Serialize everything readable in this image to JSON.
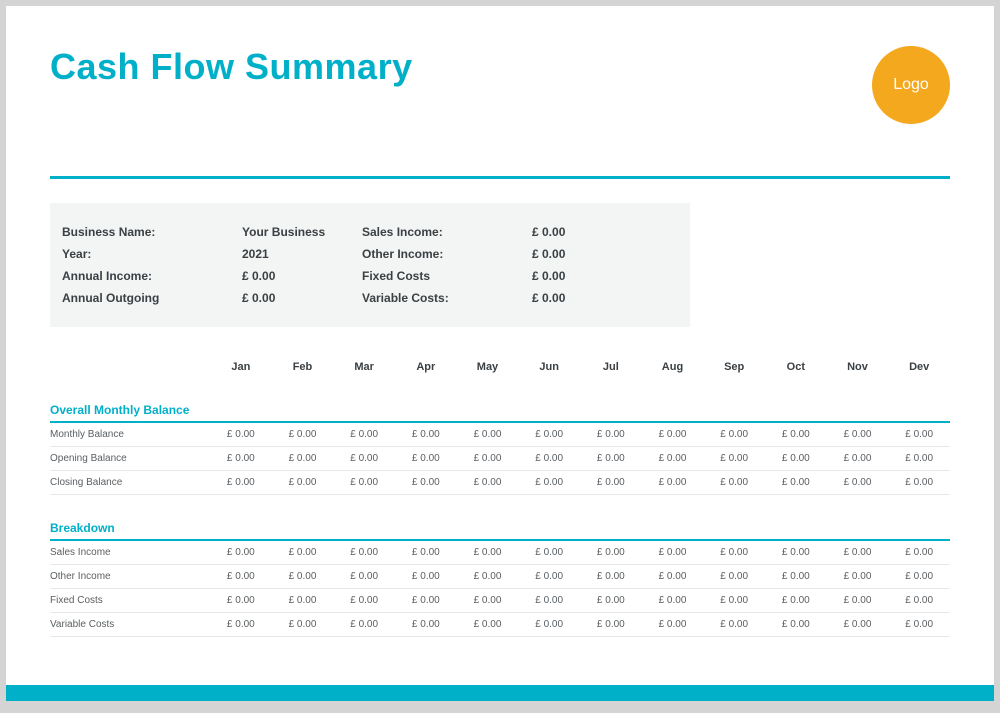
{
  "title": "Cash Flow Summary",
  "logo_text": "Logo",
  "summary": {
    "business_name_label": "Business Name:",
    "business_name_value": "Your Business",
    "year_label": "Year:",
    "year_value": "2021",
    "annual_income_label": "Annual Income:",
    "annual_income_value": "£ 0.00",
    "annual_outgoing_label": "Annual Outgoing",
    "annual_outgoing_value": "£ 0.00",
    "sales_income_label": "Sales Income:",
    "sales_income_value": "£ 0.00",
    "other_income_label": "Other Income:",
    "other_income_value": "£ 0.00",
    "fixed_costs_label": "Fixed Costs",
    "fixed_costs_value": "£ 0.00",
    "variable_costs_label": "Variable Costs:",
    "variable_costs_value": "£ 0.00"
  },
  "months": [
    "Jan",
    "Feb",
    "Mar",
    "Apr",
    "May",
    "Jun",
    "Jul",
    "Aug",
    "Sep",
    "Oct",
    "Nov",
    "Dev"
  ],
  "section1_title": "Overall Monthly Balance",
  "section2_title": "Breakdown",
  "default_cell": "£ 0.00",
  "s1": {
    "r0": "Monthly Balance",
    "r1": "Opening Balance",
    "r2": "Closing Balance"
  },
  "s2": {
    "r0": "Sales Income",
    "r1": "Other Income",
    "r2": "Fixed Costs",
    "r3": "Variable Costs"
  }
}
